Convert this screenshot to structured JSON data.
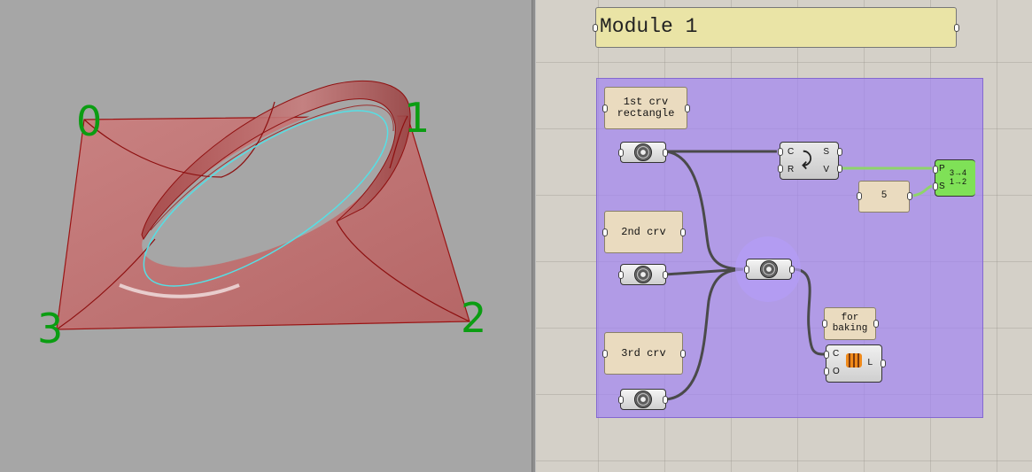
{
  "viewport": {
    "corner_labels": [
      "0",
      "1",
      "2",
      "3"
    ],
    "colors": {
      "background": "#a6a6a6",
      "surface": "#c86b6b",
      "edge": "#a41010",
      "curve": "#54e0e6",
      "label": "#0b9d12"
    }
  },
  "canvas": {
    "group_title": "Module 1",
    "panels": {
      "first": "1st crv\nrectangle",
      "second": "2nd crv",
      "third": "3rd crv",
      "slider": "5",
      "baking": "for\nbaking"
    },
    "divide_component": {
      "inputs": [
        "C",
        "R"
      ],
      "outputs": [
        "S",
        "V"
      ]
    },
    "sort_component": {
      "inputs": [
        "P",
        "S"
      ],
      "glyph": "3→4 1→2"
    },
    "loft_component": {
      "inputs": [
        "C",
        "O"
      ],
      "outputs": [
        "L"
      ]
    },
    "colors": {
      "group_fill": "#a082f5",
      "title_fill": "#eae4a6",
      "panel_fill": "#eadbbf",
      "sort_fill": "#7fe157",
      "wire": "#4a4a4a",
      "wire_green": "#8ed46a"
    }
  }
}
